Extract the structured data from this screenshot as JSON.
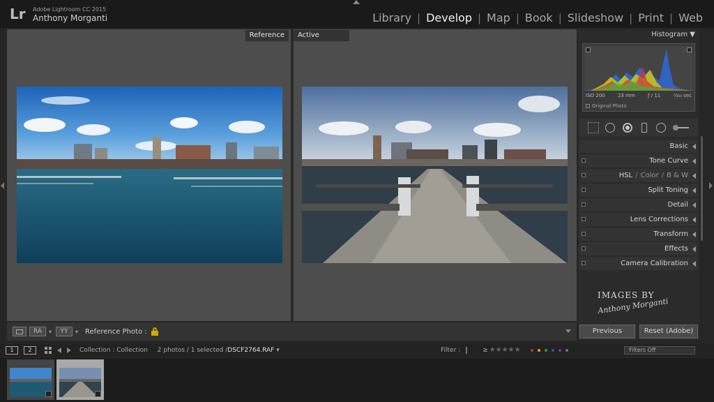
{
  "app": {
    "logo": "Lr",
    "name": "Adobe Lightroom CC 2015",
    "user": "Anthony Morganti"
  },
  "modules": [
    {
      "label": "Library",
      "active": false
    },
    {
      "label": "Develop",
      "active": true
    },
    {
      "label": "Map",
      "active": false
    },
    {
      "label": "Book",
      "active": false
    },
    {
      "label": "Slideshow",
      "active": false
    },
    {
      "label": "Print",
      "active": false
    },
    {
      "label": "Web",
      "active": false
    }
  ],
  "compare": {
    "reference_label": "Reference",
    "active_label": "Active"
  },
  "toolbar": {
    "ra_label": "RA",
    "yy_label": "YY",
    "reference_photo_label": "Reference Photo :"
  },
  "histogram": {
    "title": "Histogram",
    "iso": "ISO 200",
    "focal": "23 mm",
    "aperture": "ƒ / 11",
    "shutter": "¹⁄₃₅₀ sec",
    "original_photo": "Original Photo"
  },
  "panels": {
    "basic": "Basic",
    "tone_curve": "Tone Curve",
    "hsl": "HSL",
    "color": "Color",
    "bw": "B & W",
    "split_toning": "Split Toning",
    "detail": "Detail",
    "lens_corrections": "Lens Corrections",
    "transform": "Transform",
    "effects": "Effects",
    "camera_calibration": "Camera Calibration"
  },
  "watermark": {
    "line1": "IMAGES BY",
    "line2": "Anthony Morganti"
  },
  "buttons": {
    "previous": "Previous",
    "reset": "Reset (Adobe)"
  },
  "filmstrip_bar": {
    "screen1": "1",
    "screen2": "2",
    "collection": "Collection : Collection",
    "selection_prefix": "2 photos / 1 selected /",
    "selection_file": "DSCF2764.RAF",
    "filter_label": "Filter :",
    "filter_gte": "≥",
    "stars": "★★★★★",
    "filters_off": "Filters Off"
  },
  "colors": {
    "accent_active": "#f0f0f0",
    "label_red": "#c03030",
    "label_yellow": "#c8b000",
    "label_green": "#2f9a2f",
    "label_blue": "#3050c0",
    "label_purple": "#8030a0"
  }
}
